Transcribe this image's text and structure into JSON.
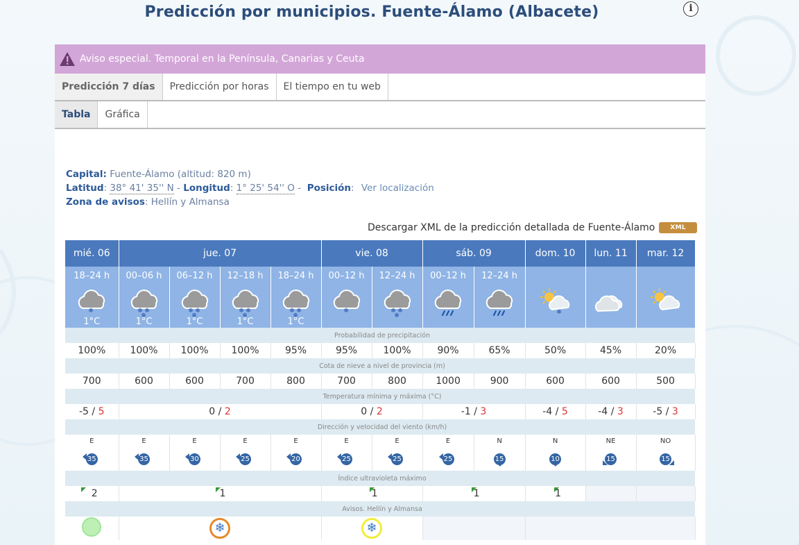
{
  "page": {
    "title": "Predicción por municipios. Fuente-Álamo (Albacete)",
    "info_icon": "info-icon"
  },
  "alert": {
    "text": "Aviso especial. Temporal en la Península, Canarias y Ceuta",
    "icon": "warning-icon",
    "color": "#d3a6d8"
  },
  "tabs_main": [
    {
      "label": "Predicción 7 días",
      "active": true
    },
    {
      "label": "Predicción por horas",
      "active": false
    },
    {
      "label": "El tiempo en tu web",
      "active": false
    }
  ],
  "tabs_sub": [
    {
      "label": "Tabla",
      "active": true
    },
    {
      "label": "Gráfica",
      "active": false
    }
  ],
  "info": {
    "capital_label": "Capital:",
    "capital_value": " Fuente-Álamo (altitud: 820 m)",
    "lat_label": "Latitud",
    "lat_value": "38° 41' 35'' N",
    "lon_label": "Longitud",
    "lon_value": "1° 25' 54'' O",
    "pos_label": "Posición",
    "pos_link": "Ver localización",
    "zona_label": "Zona de avisos",
    "zona_value": ": Hellín y Almansa"
  },
  "xml": {
    "text": "Descargar XML de la predicción detallada de Fuente-Álamo",
    "badge": "XML"
  },
  "days": [
    {
      "label": "mié. 06",
      "span": 1
    },
    {
      "label": "jue. 07",
      "span": 4
    },
    {
      "label": "vie. 08",
      "span": 2
    },
    {
      "label": "sáb. 09",
      "span": 2
    },
    {
      "label": "dom. 10",
      "span": 1
    },
    {
      "label": "lun. 11",
      "span": 1
    },
    {
      "label": "mar. 12",
      "span": 1
    }
  ],
  "periods": [
    {
      "h": "18–24 h",
      "icon": "cloud-snow-icon",
      "t": "1°C"
    },
    {
      "h": "00–06 h",
      "icon": "cloud-heavy-snow-icon",
      "t": "1°C"
    },
    {
      "h": "06–12 h",
      "icon": "cloud-heavy-snow-icon",
      "t": "1°C"
    },
    {
      "h": "12–18 h",
      "icon": "cloud-heavy-snow-icon",
      "t": "1°C"
    },
    {
      "h": "18–24 h",
      "icon": "cloud-heavy-snow-icon",
      "t": "1°C"
    },
    {
      "h": "00–12 h",
      "icon": "cloud-snow-icon",
      "t": ""
    },
    {
      "h": "12–24 h",
      "icon": "cloud-heavy-snow-icon",
      "t": ""
    },
    {
      "h": "00–12 h",
      "icon": "cloud-rain-icon",
      "t": ""
    },
    {
      "h": "12–24 h",
      "icon": "cloud-rain-icon",
      "t": ""
    },
    {
      "h": "",
      "icon": "sun-cloud-snow-icon",
      "t": ""
    },
    {
      "h": "",
      "icon": "cloud-icon",
      "t": ""
    },
    {
      "h": "",
      "icon": "sun-cloud-icon",
      "t": ""
    }
  ],
  "labels": {
    "precip": "Probabilidad de precipitación",
    "nieve": "Cota de nieve a nivel de provincia (m)",
    "temp": "Temperatura mínima y máxima (°C)",
    "viento": "Dirección y velocidad del viento (km/h)",
    "uv": "Índice ultravioleta máximo",
    "avisos": "Avisos. Hellín y Almansa"
  },
  "precip": [
    "100%",
    "100%",
    "100%",
    "100%",
    "95%",
    "95%",
    "100%",
    "90%",
    "65%",
    "50%",
    "45%",
    "20%"
  ],
  "nieve": [
    "700",
    "600",
    "600",
    "700",
    "800",
    "700",
    "800",
    "1000",
    "900",
    "600",
    "600",
    "500"
  ],
  "temps": [
    {
      "min": "-5",
      "max": "5",
      "span": 1
    },
    {
      "min": "0",
      "max": "2",
      "span": 4
    },
    {
      "min": "0",
      "max": "2",
      "span": 2
    },
    {
      "min": "-1",
      "max": "3",
      "span": 2
    },
    {
      "min": "-4",
      "max": "5",
      "span": 1
    },
    {
      "min": "-4",
      "max": "3",
      "span": 1
    },
    {
      "min": "-5",
      "max": "3",
      "span": 1
    }
  ],
  "wind": [
    {
      "dir": "E",
      "speed": "35"
    },
    {
      "dir": "E",
      "speed": "35"
    },
    {
      "dir": "E",
      "speed": "30"
    },
    {
      "dir": "E",
      "speed": "25"
    },
    {
      "dir": "E",
      "speed": "20"
    },
    {
      "dir": "E",
      "speed": "25"
    },
    {
      "dir": "E",
      "speed": "25"
    },
    {
      "dir": "E",
      "speed": "25"
    },
    {
      "dir": "N",
      "speed": "15"
    },
    {
      "dir": "N",
      "speed": "10"
    },
    {
      "dir": "NE",
      "speed": "15"
    },
    {
      "dir": "NO",
      "speed": "15"
    }
  ],
  "uv": [
    {
      "value": "2",
      "span": 1
    },
    {
      "value": "1",
      "span": 4
    },
    {
      "value": "1",
      "span": 2
    },
    {
      "value": "1",
      "span": 2
    },
    {
      "value": "1",
      "span": 1
    },
    {
      "value": "",
      "span": 1
    },
    {
      "value": "",
      "span": 1
    }
  ],
  "avisos": [
    {
      "type": "green",
      "span": 1,
      "icon": "no-warning-icon"
    },
    {
      "type": "orange",
      "span": 4,
      "icon": "snowflake-icon"
    },
    {
      "type": "yellow",
      "span": 2,
      "icon": "snowflake-icon"
    },
    {
      "type": "",
      "span": 2
    },
    {
      "type": "",
      "span": 3
    }
  ]
}
